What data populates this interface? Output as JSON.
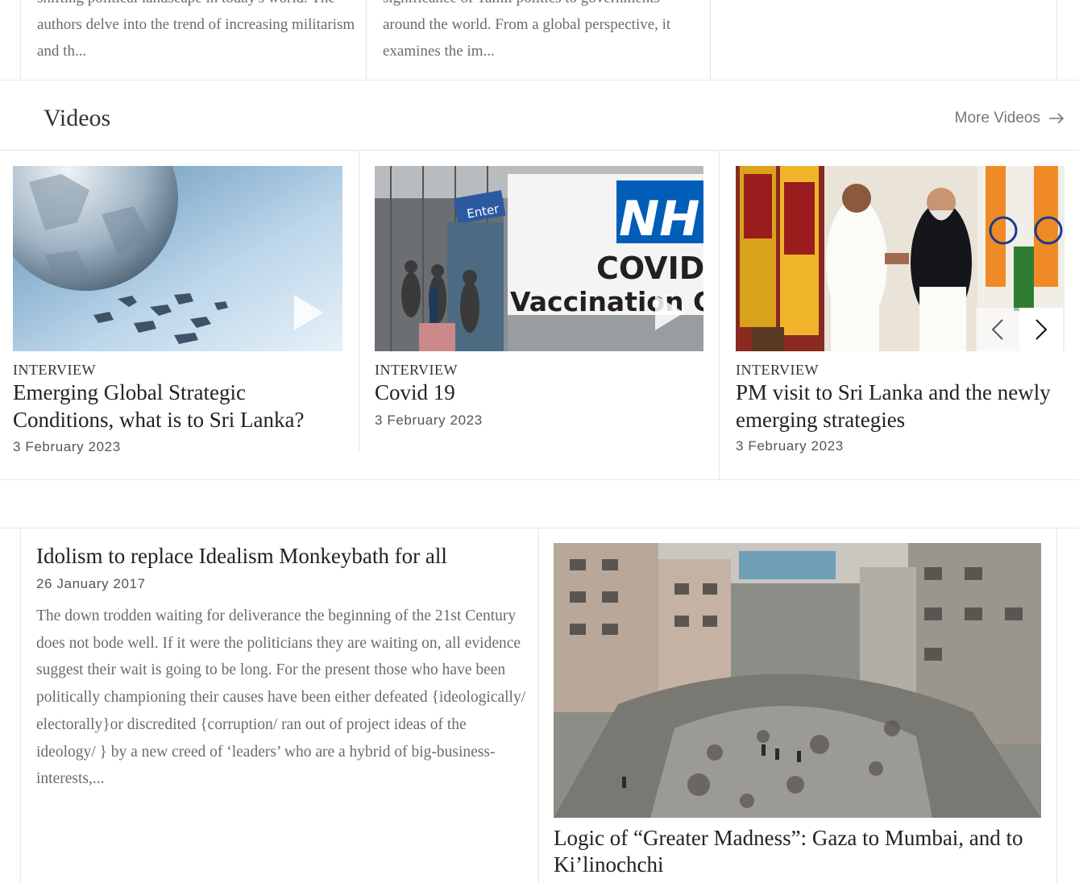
{
  "top_cards": [
    {
      "excerpt": "shifting political landscape in today's world. The authors delve into the trend of increasing militarism and th..."
    },
    {
      "excerpt": "significance of Tamil politics to governments around the world. From a global perspective, it examines the im..."
    }
  ],
  "videos": {
    "title": "Videos",
    "more_label": "More Videos",
    "items": [
      {
        "category": "INTERVIEW",
        "title": "Emerging Global Strategic Conditions, what is to Sri Lanka?",
        "date": "3 February 2023"
      },
      {
        "category": "INTERVIEW",
        "title": "Covid 19",
        "date": "3 February 2023",
        "sign_enter": "Enter",
        "sign_nhs": "NH",
        "sign_covid": "COVID-",
        "sign_vacc": "Vaccination Cen"
      },
      {
        "category": "INTERVIEW",
        "title": "PM visit to Sri Lanka and the newly emerging strategies",
        "date": "3 February 2023"
      }
    ],
    "icons": {
      "play": "play-icon",
      "prev": "chevron-left-icon",
      "next": "chevron-right-icon",
      "arrow": "arrow-right-icon"
    }
  },
  "article": {
    "title": "Idolism to replace Idealism Monkeybath for all",
    "date": "26 January 2017",
    "excerpt": "The down trodden waiting for deliverance the beginning of the 21st Century does not bode well. If it were the politicians they are waiting on, all evidence suggest their wait is going to be long. For the present those who have been politically championing their causes have been either defeated {ideologically/ electorally}or discredited {corruption/ ran out of project ideas of the ideology/ } by a new creed of ‘leaders’ who are a hybrid of big-business-interests,..."
  },
  "feature": {
    "title": "Logic of “Greater Madness”: Gaza to Mumbai, and to Ki’linochchi"
  },
  "colors": {
    "border": "#e6e6e6",
    "muted_text": "#6b6b6b",
    "heading_text": "#222222",
    "nhs_blue": "#005eb8"
  }
}
